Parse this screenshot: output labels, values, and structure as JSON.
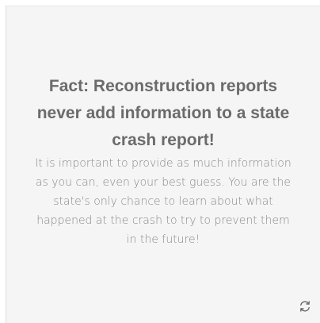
{
  "card": {
    "title": "Fact: Reconstruction reports never add information to a state crash report!",
    "body": "It is important to provide as much information as you can, even your best guess. You are the state's only chance to learn about what happened at the crash to try to prevent them in the future!",
    "refresh_icon": "refresh-icon"
  },
  "colors": {
    "card_background": "#f5f5f5",
    "title": "#6b6b6b",
    "body": "#8a8a8a",
    "icon": "#666666"
  }
}
